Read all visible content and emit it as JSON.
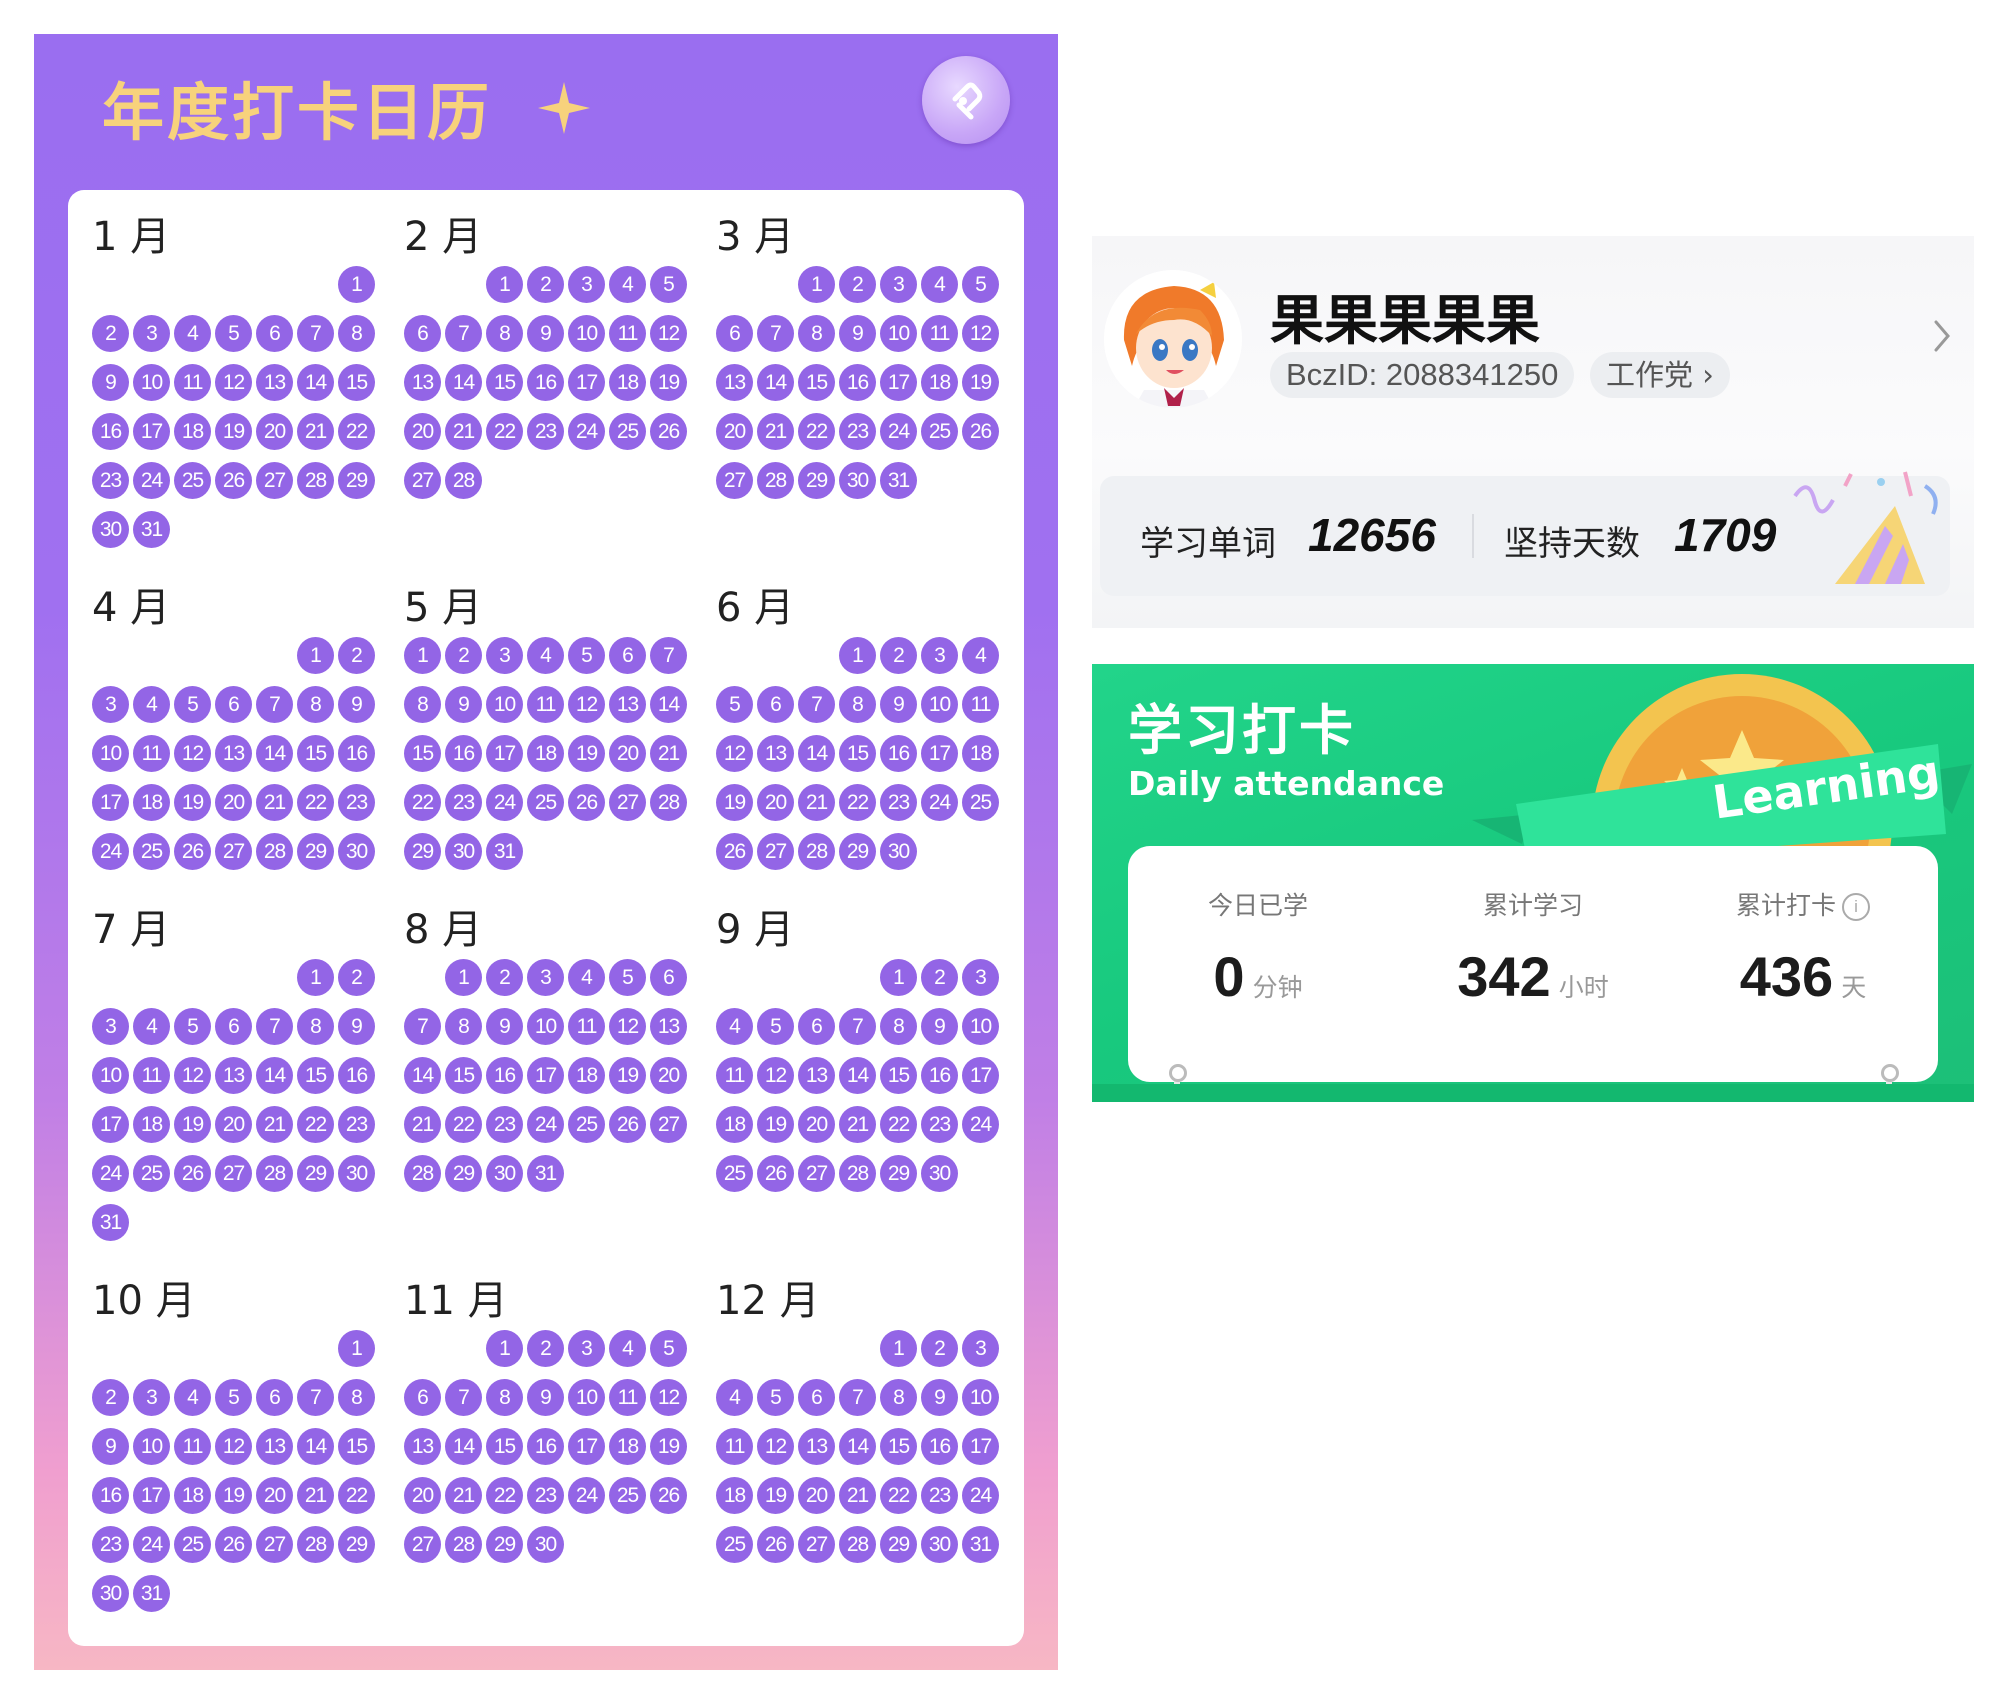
{
  "calendar": {
    "title": "年度打卡日历",
    "months": [
      {
        "label": "1 月",
        "offset": 6,
        "days": 31
      },
      {
        "label": "2 月",
        "offset": 2,
        "days": 28
      },
      {
        "label": "3 月",
        "offset": 2,
        "days": 31
      },
      {
        "label": "4 月",
        "offset": 5,
        "days": 30
      },
      {
        "label": "5 月",
        "offset": 0,
        "days": 31
      },
      {
        "label": "6 月",
        "offset": 3,
        "days": 30
      },
      {
        "label": "7 月",
        "offset": 5,
        "days": 31
      },
      {
        "label": "8 月",
        "offset": 1,
        "days": 31
      },
      {
        "label": "9 月",
        "offset": 4,
        "days": 30
      },
      {
        "label": "10 月",
        "offset": 6,
        "days": 31
      },
      {
        "label": "11 月",
        "offset": 2,
        "days": 30
      },
      {
        "label": "12 月",
        "offset": 4,
        "days": 31
      }
    ]
  },
  "profile": {
    "username": "果果果果果",
    "bcz_id": "BczID: 2088341250",
    "tag": "工作党 ›",
    "words_label": "学习单词",
    "words_value": "12656",
    "days_label": "坚持天数",
    "days_value": "1709"
  },
  "attendance": {
    "title": "学习打卡",
    "subtitle": "Daily attendance",
    "badge_text": "Learning",
    "today_label": "今日已学",
    "today_value": "0",
    "today_unit": "分钟",
    "total_study_label": "累计学习",
    "total_study_value": "342",
    "total_study_unit": "小时",
    "total_checkin_label": "累计打卡",
    "total_checkin_value": "436",
    "total_checkin_unit": "天",
    "info_icon": "i"
  },
  "colors": {
    "calendar_day": "#9365e6",
    "title_gold": "#f7d27c",
    "attendance_green": "#1dc77d"
  }
}
